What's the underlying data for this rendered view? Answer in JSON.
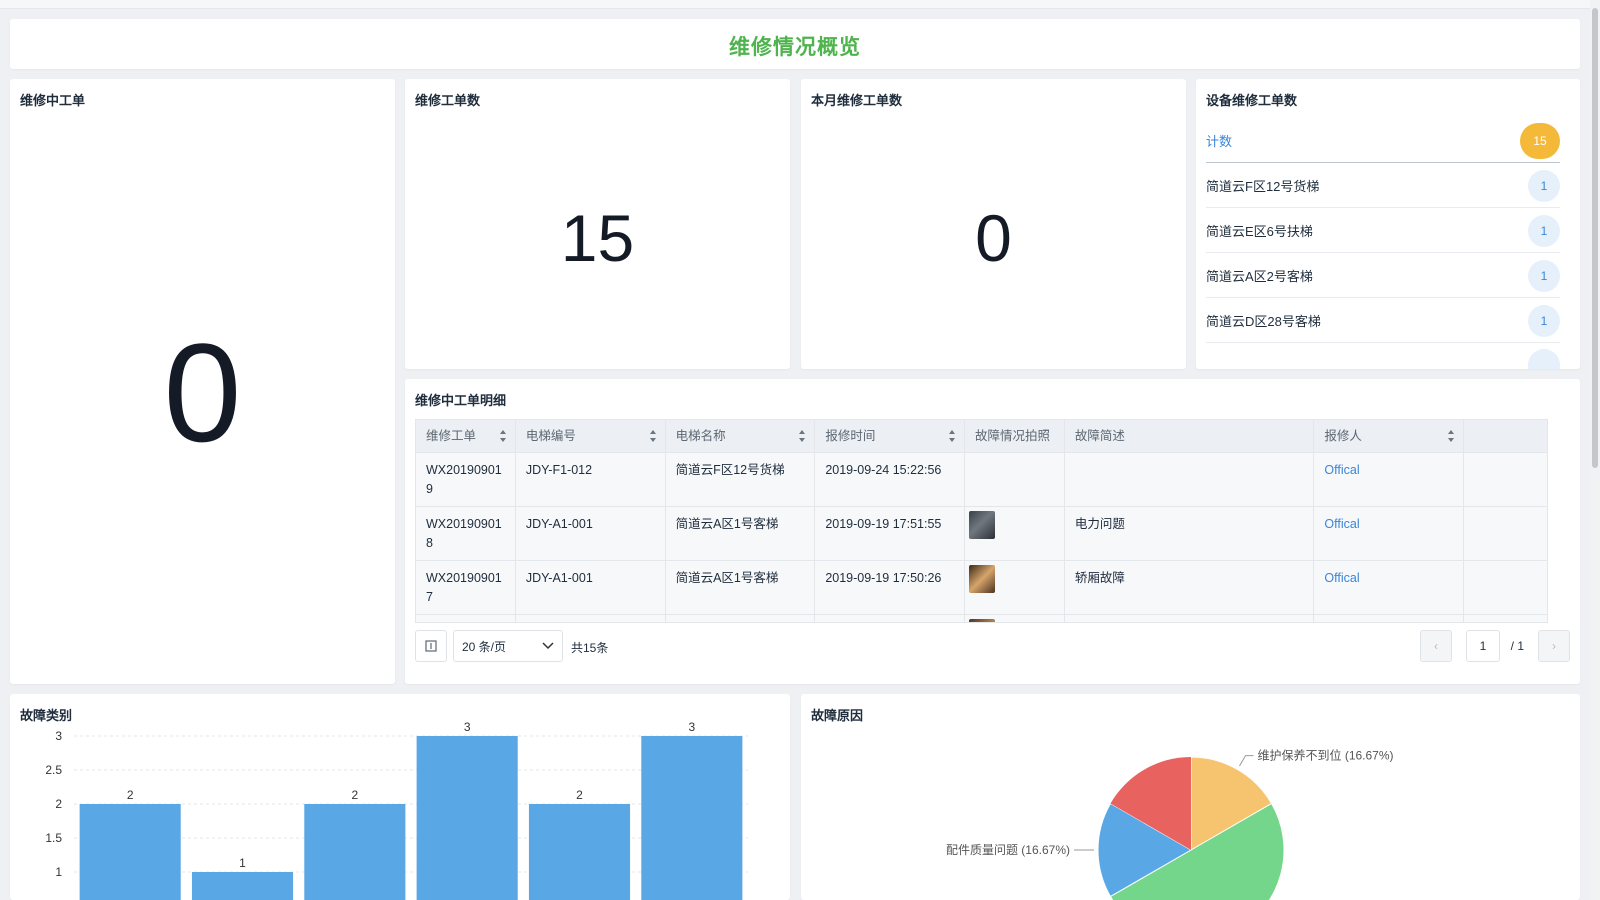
{
  "page": {
    "title": "维修情况概览"
  },
  "cards": {
    "in_progress": {
      "title": "维修中工单",
      "value": "0"
    },
    "total": {
      "title": "维修工单数",
      "value": "15"
    },
    "this_month": {
      "title": "本月维修工单数",
      "value": "0"
    },
    "device": {
      "title": "设备维修工单数",
      "count_label": "计数",
      "count_value": "15",
      "items": [
        {
          "name": "简道云F区12号货梯",
          "count": "1"
        },
        {
          "name": "简道云E区6号扶梯",
          "count": "1"
        },
        {
          "name": "简道云A区2号客梯",
          "count": "1"
        },
        {
          "name": "简道云D区28号客梯",
          "count": "1"
        }
      ]
    }
  },
  "detail": {
    "title": "维修中工单明细",
    "columns": [
      "维修工单",
      "电梯编号",
      "电梯名称",
      "报修时间",
      "故障情况拍照",
      "故障简述",
      "报修人"
    ],
    "rows": [
      {
        "order_l1": "WX20190901",
        "order_l2": "9",
        "code": "JDY-F1-012",
        "name": "简道云F区12号货梯",
        "time": "2019-09-24 15:22:56",
        "photo": "",
        "desc": "",
        "reporter": "Offical"
      },
      {
        "order_l1": "WX20190901",
        "order_l2": "8",
        "code": "JDY-A1-001",
        "name": "简道云A区1号客梯",
        "time": "2019-09-19 17:51:55",
        "photo": "t1",
        "desc": "电力问题",
        "reporter": "Offical"
      },
      {
        "order_l1": "WX20190901",
        "order_l2": "7",
        "code": "JDY-A1-001",
        "name": "简道云A区1号客梯",
        "time": "2019-09-19 17:50:26",
        "photo": "t2",
        "desc": "轿厢故障",
        "reporter": "Offical"
      }
    ],
    "pager": {
      "page_size": "20 条/页",
      "total": "共15条",
      "current": "1",
      "of_total": "/ 1"
    }
  },
  "charts": {
    "fault_type_title": "故障类别",
    "fault_reason_title": "故障原因"
  },
  "chart_data": [
    {
      "type": "bar",
      "title": "故障类别",
      "categories": [
        "",
        "",
        "",
        "",
        "",
        ""
      ],
      "values": [
        2,
        1,
        2,
        3,
        2,
        3
      ],
      "y_ticks": [
        "3",
        "2.5",
        "2",
        "1.5",
        "1"
      ],
      "ylim": [
        0,
        3
      ],
      "color": "#5aa7e6",
      "grid": true
    },
    {
      "type": "pie",
      "title": "故障原因",
      "slices": [
        {
          "label": "维护保养不到位",
          "percent": 16.67,
          "color": "#f6c46e",
          "text": "维护保养不到位 (16.67%)"
        },
        {
          "label": "",
          "percent": 50.0,
          "color": "#74d68a",
          "text": ""
        },
        {
          "label": "配件质量问题",
          "percent": 16.67,
          "color": "#5aa7e6",
          "text": "配件质量问题 (16.67%)"
        }
      ]
    }
  ]
}
